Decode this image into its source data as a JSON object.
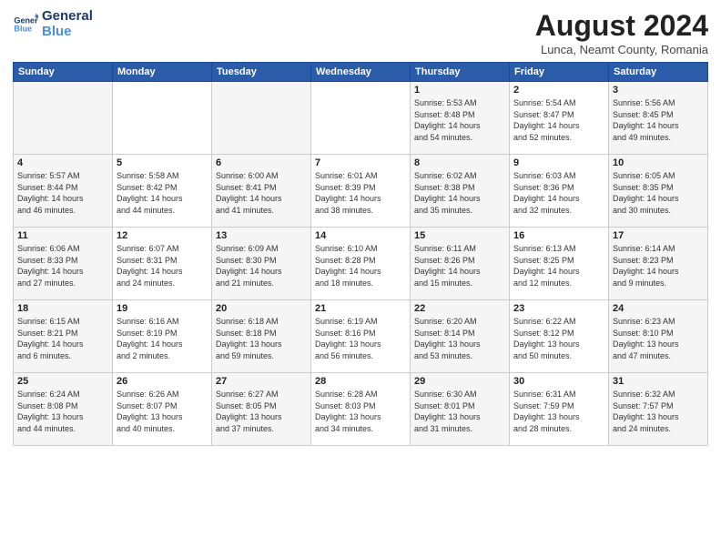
{
  "header": {
    "logo_line1": "General",
    "logo_line2": "Blue",
    "month_year": "August 2024",
    "location": "Lunca, Neamt County, Romania"
  },
  "days_of_week": [
    "Sunday",
    "Monday",
    "Tuesday",
    "Wednesday",
    "Thursday",
    "Friday",
    "Saturday"
  ],
  "weeks": [
    [
      {
        "num": "",
        "info": ""
      },
      {
        "num": "",
        "info": ""
      },
      {
        "num": "",
        "info": ""
      },
      {
        "num": "",
        "info": ""
      },
      {
        "num": "1",
        "info": "Sunrise: 5:53 AM\nSunset: 8:48 PM\nDaylight: 14 hours\nand 54 minutes."
      },
      {
        "num": "2",
        "info": "Sunrise: 5:54 AM\nSunset: 8:47 PM\nDaylight: 14 hours\nand 52 minutes."
      },
      {
        "num": "3",
        "info": "Sunrise: 5:56 AM\nSunset: 8:45 PM\nDaylight: 14 hours\nand 49 minutes."
      }
    ],
    [
      {
        "num": "4",
        "info": "Sunrise: 5:57 AM\nSunset: 8:44 PM\nDaylight: 14 hours\nand 46 minutes."
      },
      {
        "num": "5",
        "info": "Sunrise: 5:58 AM\nSunset: 8:42 PM\nDaylight: 14 hours\nand 44 minutes."
      },
      {
        "num": "6",
        "info": "Sunrise: 6:00 AM\nSunset: 8:41 PM\nDaylight: 14 hours\nand 41 minutes."
      },
      {
        "num": "7",
        "info": "Sunrise: 6:01 AM\nSunset: 8:39 PM\nDaylight: 14 hours\nand 38 minutes."
      },
      {
        "num": "8",
        "info": "Sunrise: 6:02 AM\nSunset: 8:38 PM\nDaylight: 14 hours\nand 35 minutes."
      },
      {
        "num": "9",
        "info": "Sunrise: 6:03 AM\nSunset: 8:36 PM\nDaylight: 14 hours\nand 32 minutes."
      },
      {
        "num": "10",
        "info": "Sunrise: 6:05 AM\nSunset: 8:35 PM\nDaylight: 14 hours\nand 30 minutes."
      }
    ],
    [
      {
        "num": "11",
        "info": "Sunrise: 6:06 AM\nSunset: 8:33 PM\nDaylight: 14 hours\nand 27 minutes."
      },
      {
        "num": "12",
        "info": "Sunrise: 6:07 AM\nSunset: 8:31 PM\nDaylight: 14 hours\nand 24 minutes."
      },
      {
        "num": "13",
        "info": "Sunrise: 6:09 AM\nSunset: 8:30 PM\nDaylight: 14 hours\nand 21 minutes."
      },
      {
        "num": "14",
        "info": "Sunrise: 6:10 AM\nSunset: 8:28 PM\nDaylight: 14 hours\nand 18 minutes."
      },
      {
        "num": "15",
        "info": "Sunrise: 6:11 AM\nSunset: 8:26 PM\nDaylight: 14 hours\nand 15 minutes."
      },
      {
        "num": "16",
        "info": "Sunrise: 6:13 AM\nSunset: 8:25 PM\nDaylight: 14 hours\nand 12 minutes."
      },
      {
        "num": "17",
        "info": "Sunrise: 6:14 AM\nSunset: 8:23 PM\nDaylight: 14 hours\nand 9 minutes."
      }
    ],
    [
      {
        "num": "18",
        "info": "Sunrise: 6:15 AM\nSunset: 8:21 PM\nDaylight: 14 hours\nand 6 minutes."
      },
      {
        "num": "19",
        "info": "Sunrise: 6:16 AM\nSunset: 8:19 PM\nDaylight: 14 hours\nand 2 minutes."
      },
      {
        "num": "20",
        "info": "Sunrise: 6:18 AM\nSunset: 8:18 PM\nDaylight: 13 hours\nand 59 minutes."
      },
      {
        "num": "21",
        "info": "Sunrise: 6:19 AM\nSunset: 8:16 PM\nDaylight: 13 hours\nand 56 minutes."
      },
      {
        "num": "22",
        "info": "Sunrise: 6:20 AM\nSunset: 8:14 PM\nDaylight: 13 hours\nand 53 minutes."
      },
      {
        "num": "23",
        "info": "Sunrise: 6:22 AM\nSunset: 8:12 PM\nDaylight: 13 hours\nand 50 minutes."
      },
      {
        "num": "24",
        "info": "Sunrise: 6:23 AM\nSunset: 8:10 PM\nDaylight: 13 hours\nand 47 minutes."
      }
    ],
    [
      {
        "num": "25",
        "info": "Sunrise: 6:24 AM\nSunset: 8:08 PM\nDaylight: 13 hours\nand 44 minutes."
      },
      {
        "num": "26",
        "info": "Sunrise: 6:26 AM\nSunset: 8:07 PM\nDaylight: 13 hours\nand 40 minutes."
      },
      {
        "num": "27",
        "info": "Sunrise: 6:27 AM\nSunset: 8:05 PM\nDaylight: 13 hours\nand 37 minutes."
      },
      {
        "num": "28",
        "info": "Sunrise: 6:28 AM\nSunset: 8:03 PM\nDaylight: 13 hours\nand 34 minutes."
      },
      {
        "num": "29",
        "info": "Sunrise: 6:30 AM\nSunset: 8:01 PM\nDaylight: 13 hours\nand 31 minutes."
      },
      {
        "num": "30",
        "info": "Sunrise: 6:31 AM\nSunset: 7:59 PM\nDaylight: 13 hours\nand 28 minutes."
      },
      {
        "num": "31",
        "info": "Sunrise: 6:32 AM\nSunset: 7:57 PM\nDaylight: 13 hours\nand 24 minutes."
      }
    ]
  ]
}
